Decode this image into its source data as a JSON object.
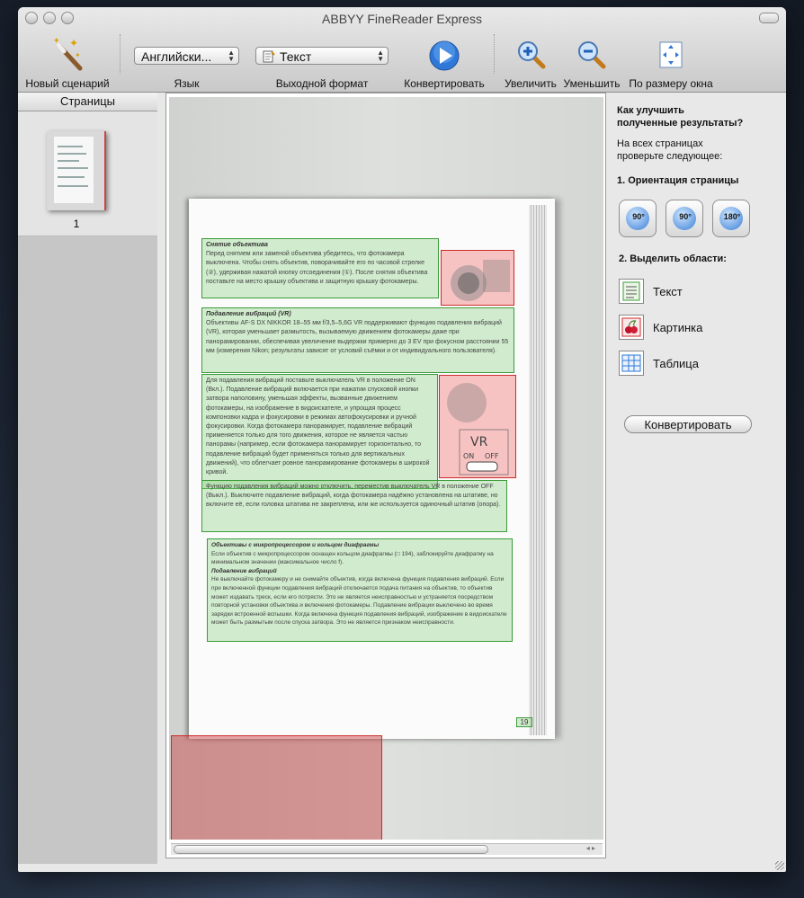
{
  "window": {
    "title": "ABBYY FineReader Express"
  },
  "toolbar": {
    "new_scenario": "Новый сценарий",
    "language_label": "Язык",
    "language_value": "Английски...",
    "output_label": "Выходной формат",
    "output_value": "Текст",
    "convert": "Конвертировать",
    "zoom_in": "Увеличить",
    "zoom_out": "Уменьшить",
    "fit": "По размеру окна"
  },
  "sidebar": {
    "header": "Страницы",
    "pages": [
      {
        "number": "1"
      }
    ]
  },
  "document": {
    "page_number": "19",
    "z1_title": "Снятие объектива",
    "z1_text": "Перед снятием или заменой объектива убедитесь, что фотокамера выключена. Чтобы снять объектив, поворачивайте его по часовой стрелке (②), удерживая нажатой кнопку отсоединения (①). После снятия объектива поставьте на место крышку объектива и защитную крышку фотокамеры.",
    "z2_title": "Подавление вибраций (VR)",
    "z2_text": "Объективы AF-S DX NIKKOR 18–55 мм f/3,5–5,6G VR поддерживают функцию подавления вибраций (VR), которая уменьшает размытость, вызываемую движением фотокамеры даже при панорамировании, обеспечивая увеличение выдержки примерно до 3 EV при фокусном расстоянии 55 мм (измерения Nikon; результаты зависят от условий съёмки и от индивидуального пользователя).",
    "z3_text": "Для подавления вибраций поставьте выключатель VR в положение ON (Вкл.). Подавление вибраций включается при нажатии спусковой кнопки затвора наполовину, уменьшая эффекты, вызванные движением фотокамеры, на изображение в видоискателе, и упрощая процесс компоновки кадра и фокусировки в режимах автофокусировки и ручной фокусировки. Когда фотокамера панорамирует, подавление вибраций применяется только для того движения, которое не является частью панорамы (например, если фотокамера панорамирует горизонтально, то подавление вибраций будет применяться только для вертикальных движений), что облегчает ровное панорамирование фотокамеры в широкой кривой.",
    "z4_text": "Функцию подавления вибраций можно отключить, переместив выключатель VR в положение OFF (Выкл.). Выключите подавление вибраций, когда фотокамера надёжно установлена на штативе, но включите её, если головка штатива не закреплена, или же используется одиночный штатив (опора).",
    "z5_t1": "Объективы с микропроцессором и кольцом диафрагмы",
    "z5_p1": "Если объектив с микропроцессором оснащен кольцом диафрагмы (□ 194), заблокируйте диафрагму на минимальном значении (максимальное число f).",
    "z5_t2": "Подавление вибраций",
    "z5_p2": "Не выключайте фотокамеру и не снимайте объектив, когда включена функция подавления вибраций. Если при включенной функции подавления вибраций отключается подача питания на объектив, то объектив может издавать треск, если его потрясти. Это не является неисправностью и устраняется посредством повторной установки объектива и включения фотокамеры. Подавление вибрации выключено во время зарядки встроенной вспышки. Когда включена функция подавления вибраций, изображение в видоискателе может быть размытым после спуска затвора. Это не является признаком неисправности.",
    "vr_label": "VR",
    "vr_on": "ON",
    "vr_off": "OFF"
  },
  "panel": {
    "heading_line1": "Как улучшить",
    "heading_line2": "полученные результаты?",
    "intro_line1": "На всех страницах",
    "intro_line2": "проверьте следующее:",
    "step1": "1. Ориентация страницы",
    "rotate_left": "90°",
    "rotate_right": "90°",
    "rotate_180": "180°",
    "step2": "2. Выделить области:",
    "area_text": "Текст",
    "area_picture": "Картинка",
    "area_table": "Таблица",
    "convert_button": "Конвертировать"
  },
  "colors": {
    "text_zone": "#3d9b3a",
    "picture_zone": "#cc2b2b",
    "accent": "#3a7fd6"
  }
}
